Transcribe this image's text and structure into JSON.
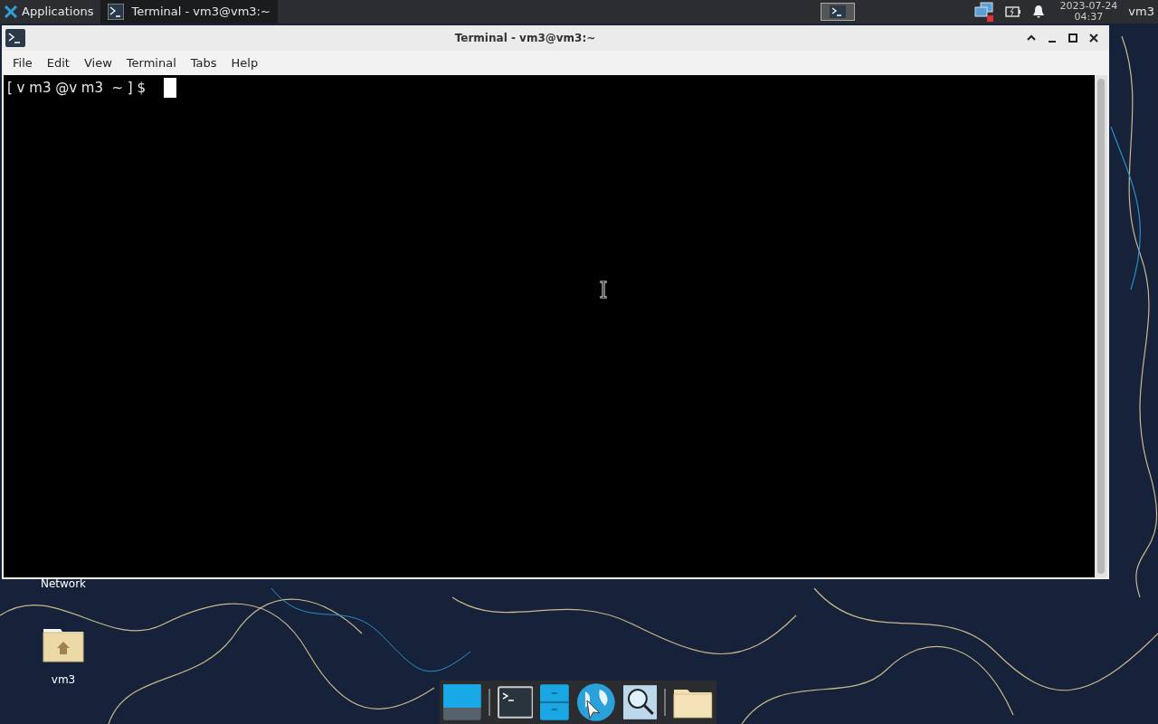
{
  "panel": {
    "applications": "Applications",
    "taskbar": [
      {
        "title": "Terminal - vm3@vm3:~",
        "selected": true
      }
    ],
    "clock": {
      "date": "2023-07-24",
      "time": "04:37"
    },
    "user": "vm3"
  },
  "window": {
    "title": "Terminal - vm3@vm3:~",
    "menu": [
      "File",
      "Edit",
      "View",
      "Terminal",
      "Tabs",
      "Help"
    ],
    "prompt": "[ v m3 @v m3  ~ ] $"
  },
  "desktop_icons": [
    {
      "label": "Network",
      "kind": "label"
    },
    {
      "label": "vm3",
      "kind": "home"
    }
  ]
}
